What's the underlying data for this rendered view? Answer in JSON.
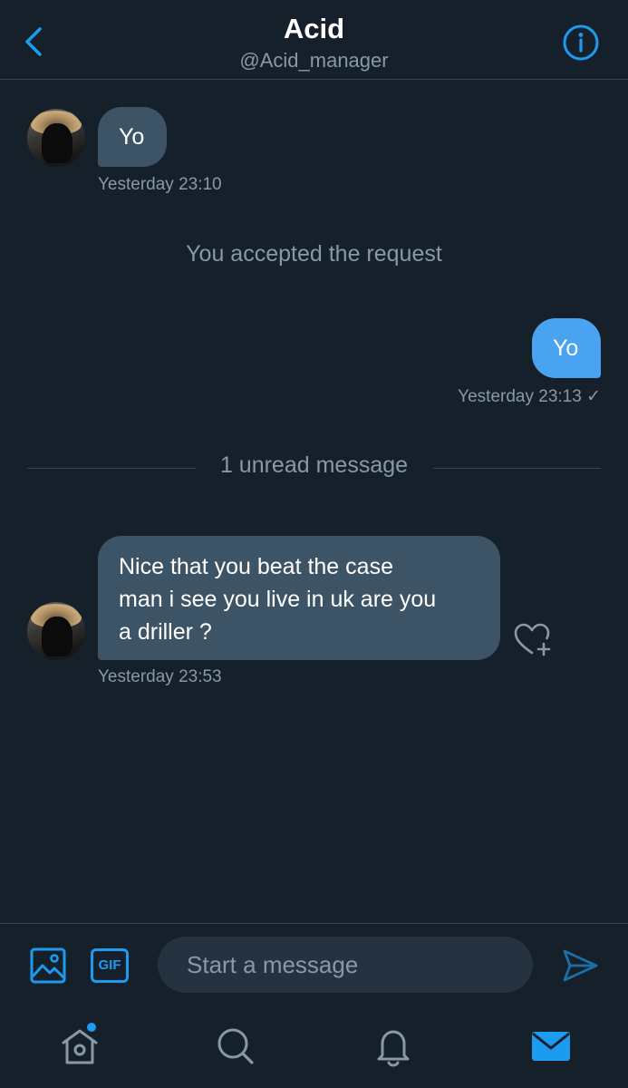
{
  "header": {
    "title": "Acid",
    "handle": "@Acid_manager"
  },
  "conversation": {
    "messages": [
      {
        "sender": "Acid",
        "direction": "incoming",
        "text": "Yo",
        "timestamp": "Yesterday 23:10"
      },
      {
        "sender": "You",
        "direction": "outgoing",
        "text": "Yo",
        "timestamp": "Yesterday 23:13 ✓"
      },
      {
        "sender": "Acid",
        "direction": "incoming",
        "lines": [
          "Nice that you beat the case",
          "man i see you live in uk are you",
          "a driller ?"
        ],
        "timestamp": "Yesterday 23:53"
      }
    ],
    "system_message": "You accepted the request",
    "unread_divider": "1 unread message"
  },
  "composer": {
    "placeholder": "Start a message",
    "gif_label": "GIF"
  },
  "icons": {
    "back": "chevron-left-icon",
    "info": "info-icon",
    "react": "heart-plus-icon",
    "media": "image-icon",
    "send": "send-icon",
    "tabs": [
      "home-icon",
      "search-icon",
      "bell-icon",
      "mail-icon"
    ]
  },
  "colors": {
    "background": "#15202b",
    "accent": "#1d9bf0",
    "incoming_bubble": "#3d5466",
    "outgoing_bubble": "#4aa3f0",
    "muted_text": "#8899a6",
    "divider": "#38444d"
  }
}
